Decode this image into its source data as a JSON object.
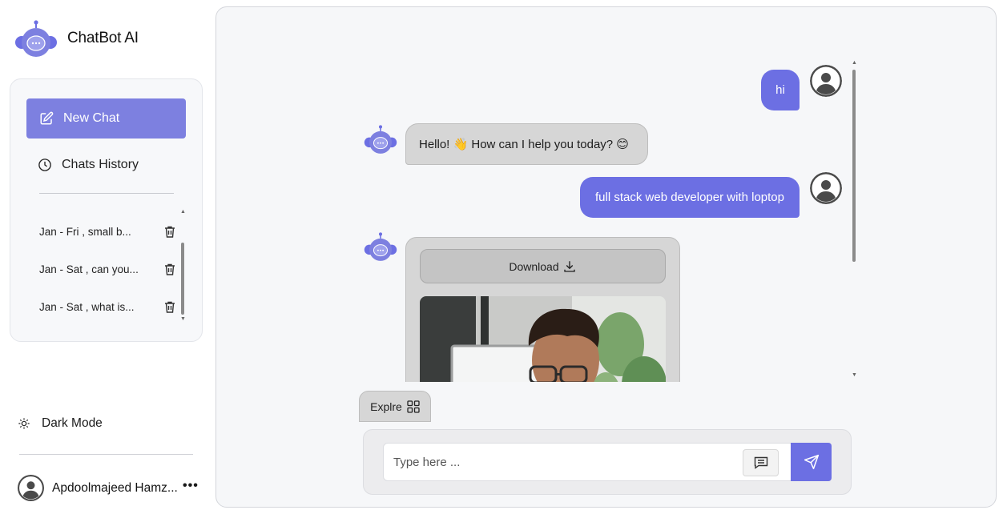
{
  "app": {
    "name": "ChatBot AI"
  },
  "sidebar": {
    "new_chat_label": "New Chat",
    "history_label": "Chats History",
    "chats": [
      {
        "title": "Jan - Fri , small b..."
      },
      {
        "title": "Jan - Sat , can you..."
      },
      {
        "title": "Jan - Sat , what is..."
      }
    ],
    "dark_mode_label": "Dark Mode",
    "user_name": "Apdoolmajeed Hamz...",
    "more_label": "•••"
  },
  "conversation": {
    "messages": [
      {
        "role": "user",
        "text": "hi"
      },
      {
        "role": "bot",
        "text": "Hello! 👋 How can I help you today? 😊"
      },
      {
        "role": "user",
        "text": "full stack web developer with loptop"
      },
      {
        "role": "bot",
        "type": "image",
        "download_label": "Download"
      }
    ]
  },
  "composer": {
    "explore_label": "Explre",
    "input_placeholder": "Type here ...",
    "input_value": ""
  },
  "colors": {
    "accent": "#6c6fe3",
    "accent_light": "#7d80e0",
    "bot_bubble": "#d6d6d6",
    "panel_bg": "#f6f7f9"
  },
  "icons": {
    "logo": "robot-logo-icon",
    "new_chat": "edit-icon",
    "history": "clock-icon",
    "delete": "trash-icon",
    "theme": "sun-icon",
    "user": "user-avatar-icon",
    "download": "download-icon",
    "explore": "grid-icon",
    "prompts": "message-icon",
    "send": "send-icon"
  }
}
